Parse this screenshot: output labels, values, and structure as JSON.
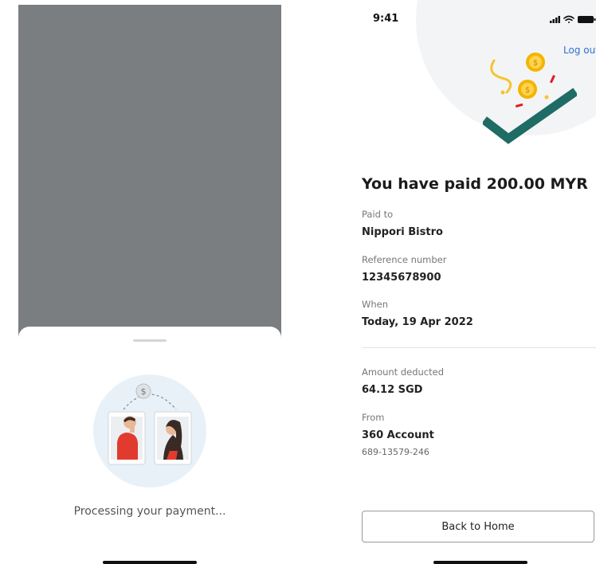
{
  "processing_screen": {
    "message": "Processing your payment..."
  },
  "success_screen": {
    "status_bar": {
      "time": "9:41"
    },
    "logout_label": "Log out",
    "headline": "You have paid 200.00 MYR",
    "details": {
      "paid_to_label": "Paid to",
      "paid_to_value": "Nippori Bistro",
      "reference_label": "Reference number",
      "reference_value": "12345678900",
      "when_label": "When",
      "when_value": "Today, 19 Apr 2022",
      "amount_label": "Amount deducted",
      "amount_value": "64.12 SGD",
      "from_label": "From",
      "from_value": "360 Account",
      "account_number": "689-13579-246"
    },
    "back_button_label": "Back to Home"
  },
  "colors": {
    "overlay": "#7b7e80",
    "link": "#2f6fd6",
    "check": "#1f6b65",
    "coin": "#f4b400",
    "person_red": "#e13b30"
  },
  "icons": [
    "dollar-coin-icon",
    "signal-icon",
    "wifi-icon",
    "battery-icon",
    "checkmark-icon"
  ]
}
